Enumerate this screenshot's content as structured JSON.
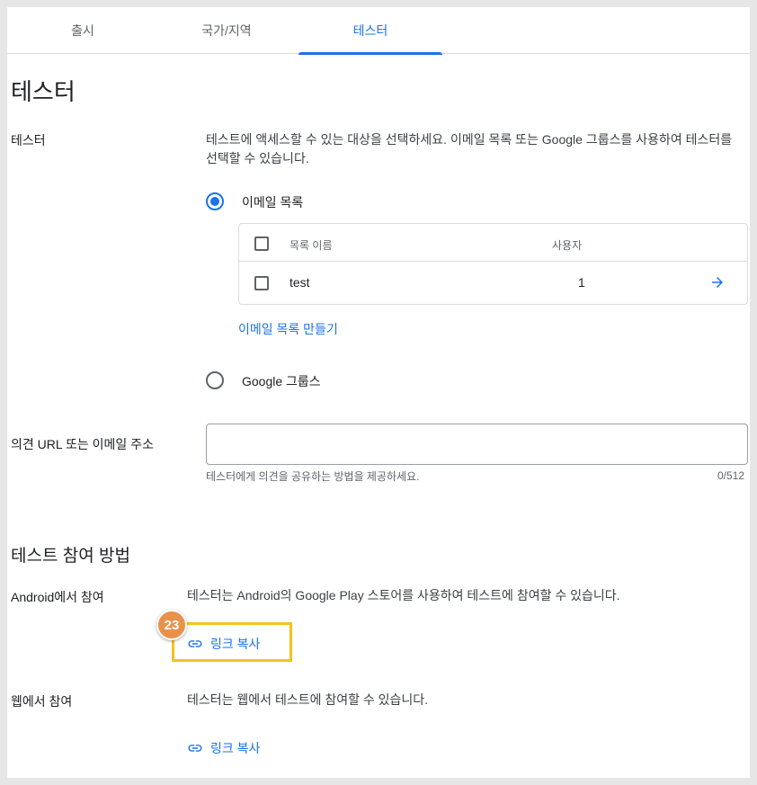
{
  "tabs": [
    {
      "label": "출시"
    },
    {
      "label": "국가/지역"
    },
    {
      "label": "테스터"
    }
  ],
  "page_title": "테스터",
  "testers": {
    "label": "테스터",
    "description": "테스트에 액세스할 수 있는 대상을 선택하세요. 이메일 목록 또는 Google 그룹스를 사용하여 테스터를 선택할 수 있습니다.",
    "option_email": "이메일 목록",
    "option_groups": "Google 그룹스",
    "table": {
      "headers": {
        "name": "목록 이름",
        "users": "사용자"
      },
      "rows": [
        {
          "name": "test",
          "users": "1"
        }
      ]
    },
    "create_list": "이메일 목록 만들기"
  },
  "feedback": {
    "label": "의견 URL 또는 이메일 주소",
    "value": "",
    "helper": "테스터에게 의견을 공유하는 방법을 제공하세요.",
    "counter": "0/512"
  },
  "how_to_join": {
    "title": "테스트 참여 방법",
    "android": {
      "label": "Android에서 참여",
      "description": "테스터는 Android의 Google Play 스토어를 사용하여 테스트에 참여할 수 있습니다.",
      "copy_link": "링크 복사"
    },
    "web": {
      "label": "웹에서 참여",
      "description": "테스터는 웹에서 테스트에 참여할 수 있습니다.",
      "copy_link": "링크 복사"
    }
  },
  "annotation": {
    "step": "23"
  },
  "colors": {
    "accent": "#1a73e8",
    "highlight": "#f5c21b",
    "badge": "#e8914a"
  }
}
